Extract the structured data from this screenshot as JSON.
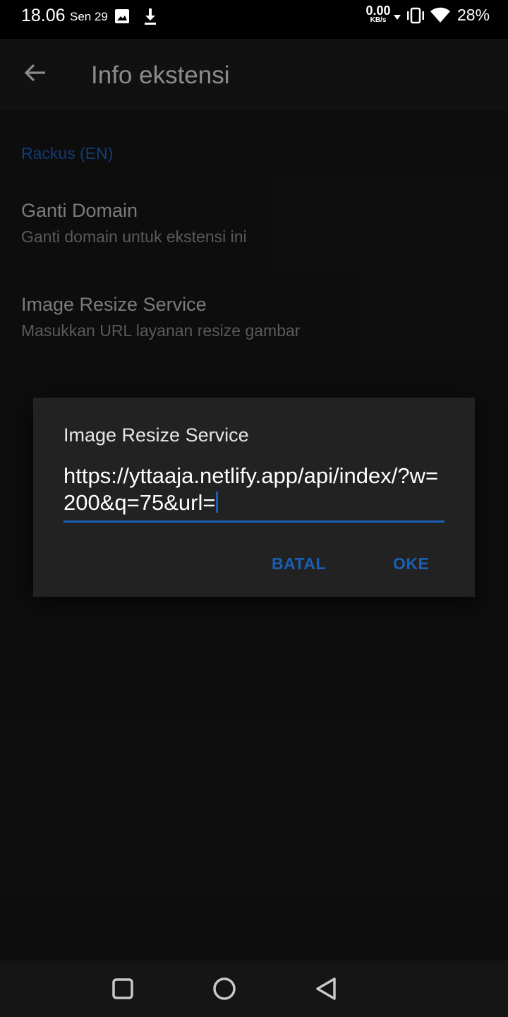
{
  "status_bar": {
    "time": "18.06",
    "date": "Sen 29",
    "net_speed_value": "0.00",
    "net_speed_unit": "KB/s",
    "battery": "28%",
    "icons": [
      "image-icon",
      "download-icon",
      "wifi-data-arrows-icon",
      "vibrate-icon",
      "wifi-icon"
    ]
  },
  "app_bar": {
    "back_icon": "arrow-left-icon",
    "title": "Info ekstensi"
  },
  "content": {
    "section_header": "Rackus (EN)",
    "prefs": [
      {
        "title": "Ganti Domain",
        "subtitle": "Ganti domain untuk ekstensi ini"
      },
      {
        "title": "Image Resize Service",
        "subtitle": "Masukkan URL layanan resize gambar"
      }
    ]
  },
  "dialog": {
    "title": "Image Resize Service",
    "input_value": "https://yttaaja.netlify.app/api/index/?w=200&q=75&url=",
    "cancel_label": "BATAL",
    "ok_label": "OKE"
  },
  "nav_bar": {
    "icons": [
      "recents-square-icon",
      "home-circle-icon",
      "back-triangle-icon"
    ]
  },
  "colors": {
    "accent": "#1a5fb4",
    "background": "#151515",
    "dialog_bg": "#222222"
  }
}
